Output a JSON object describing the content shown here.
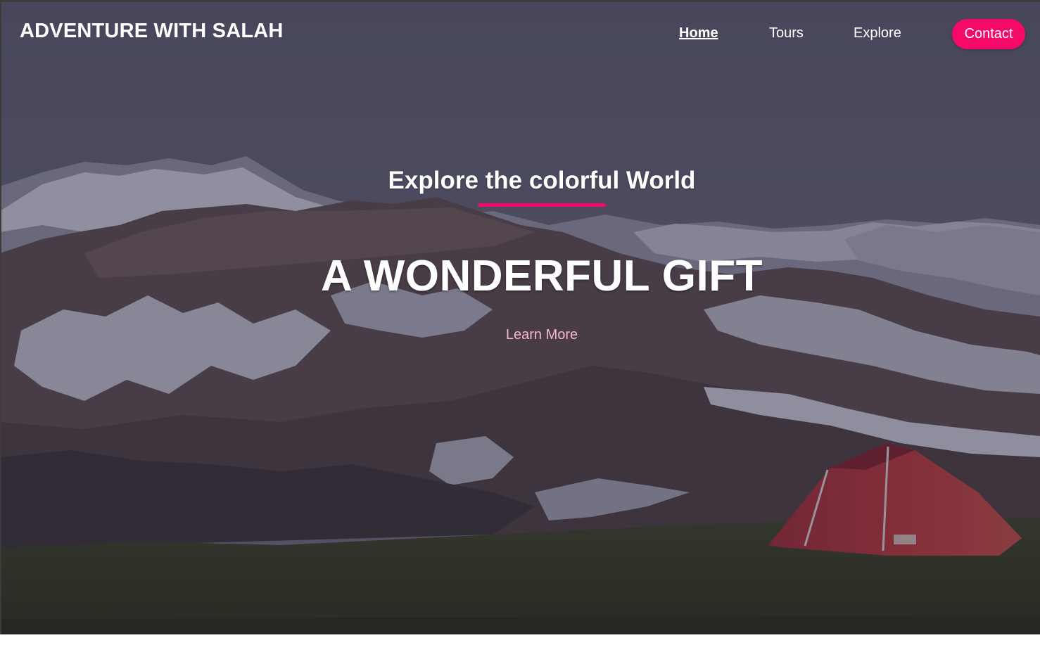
{
  "header": {
    "brand": "ADVENTURE WITH SALAH",
    "nav": {
      "home": "Home",
      "tours": "Tours",
      "explore": "Explore",
      "contact": "Contact"
    }
  },
  "hero": {
    "subtitle": "Explore the colorful World",
    "headline": "A WONDERFUL GIFT",
    "cta": "Learn More",
    "background_image": "mountain-landscape-with-red-tent"
  },
  "colors": {
    "accent": "#f50a67",
    "cta_text": "#f7b6cf",
    "overlay": "#4b4a5c"
  }
}
